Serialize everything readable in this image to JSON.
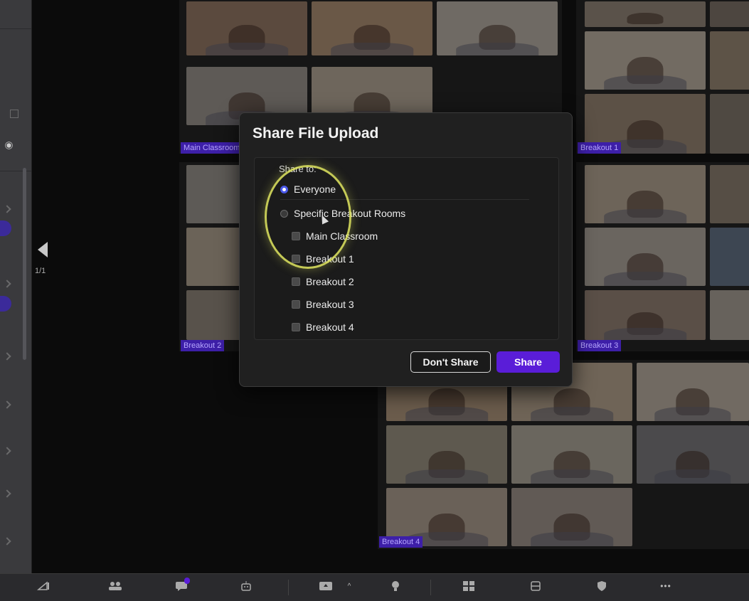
{
  "pager": {
    "page_indicator": "1/1"
  },
  "groups": [
    {
      "label": "Main Classroom"
    },
    {
      "label": "Breakout 1"
    },
    {
      "label": "Breakout 2"
    },
    {
      "label": "Breakout 3"
    },
    {
      "label": "Breakout 4"
    }
  ],
  "modal": {
    "title": "Share File Upload",
    "share_to_label": "Share to:",
    "options": {
      "everyone": "Everyone",
      "specific": "Specific Breakout Rooms"
    },
    "selected_option": "Everyone",
    "rooms": [
      "Main Classroom",
      "Breakout 1",
      "Breakout 2",
      "Breakout 3",
      "Breakout 4"
    ],
    "buttons": {
      "dont_share": "Don't Share",
      "share": "Share"
    }
  },
  "colors": {
    "accent": "#5a1dd8",
    "radio_selected": "#4a58e8",
    "highlight_ring": "#e2e860",
    "group_label_bg": "#3d1fa8"
  },
  "toolbar": {
    "icons": [
      "signal-icon",
      "participants-icon",
      "chat-icon",
      "robot-icon",
      "share-screen-icon",
      "lightbulb-icon",
      "breakout-rooms-icon",
      "whiteboard-icon",
      "security-icon",
      "more-icon"
    ],
    "more_glyph": "•••"
  }
}
